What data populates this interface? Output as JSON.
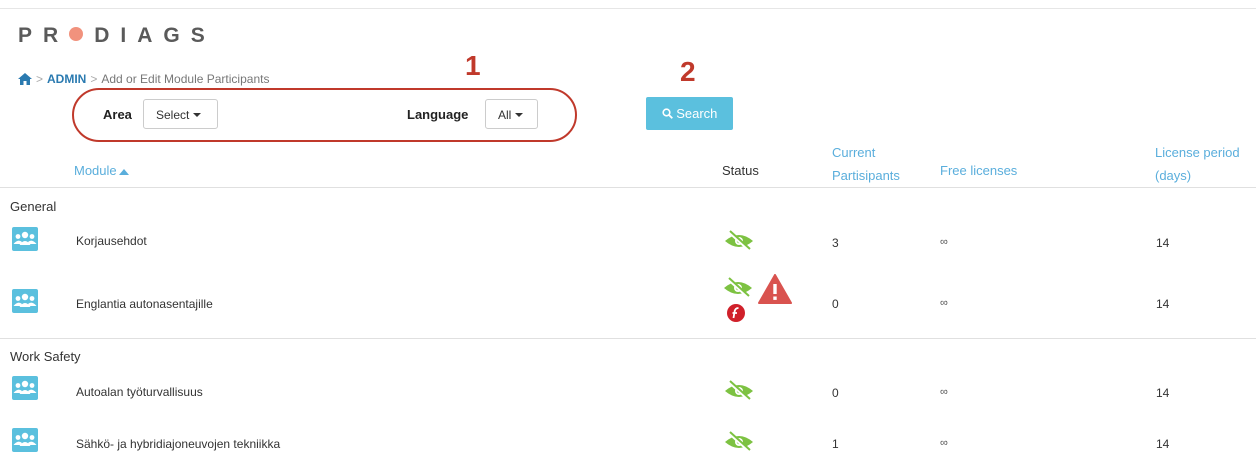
{
  "logo": {
    "before": "PR",
    "after": "DIAGS"
  },
  "breadcrumb": {
    "admin": "ADMIN",
    "page": "Add or Edit Module Participants"
  },
  "filters": {
    "area_label": "Area",
    "area_value": "Select",
    "language_label": "Language",
    "language_value": "All"
  },
  "annotations": {
    "one": "1",
    "two": "2"
  },
  "search_label": "Search",
  "columns": {
    "module": "Module",
    "status": "Status",
    "current_1": "Current",
    "current_2": "Partisipants",
    "free": "Free licenses",
    "period_1": "License period",
    "period_2": "(days)"
  },
  "groups": [
    {
      "name": "General"
    },
    {
      "name": "Work Safety"
    }
  ],
  "rows": [
    {
      "name": "Korjausehdot",
      "participants": "3",
      "free": "∞",
      "period": "14"
    },
    {
      "name": "Englantia autonasentajille",
      "participants": "0",
      "free": "∞",
      "period": "14"
    },
    {
      "name": "Autoalan työturvallisuus",
      "participants": "0",
      "free": "∞",
      "period": "14"
    },
    {
      "name": "Sähkö- ja hybridiajoneuvojen tekniikka",
      "participants": "1",
      "free": "∞",
      "period": "14"
    }
  ],
  "colors": {
    "accent": "#5bc0de",
    "link": "#5aaedc",
    "status_green": "#7dc242",
    "annotation_red": "#c0392b"
  },
  "icons": [
    "home-icon",
    "users-icon",
    "hidden-eye-icon",
    "warning-icon",
    "flash-icon",
    "sort-up-icon"
  ]
}
